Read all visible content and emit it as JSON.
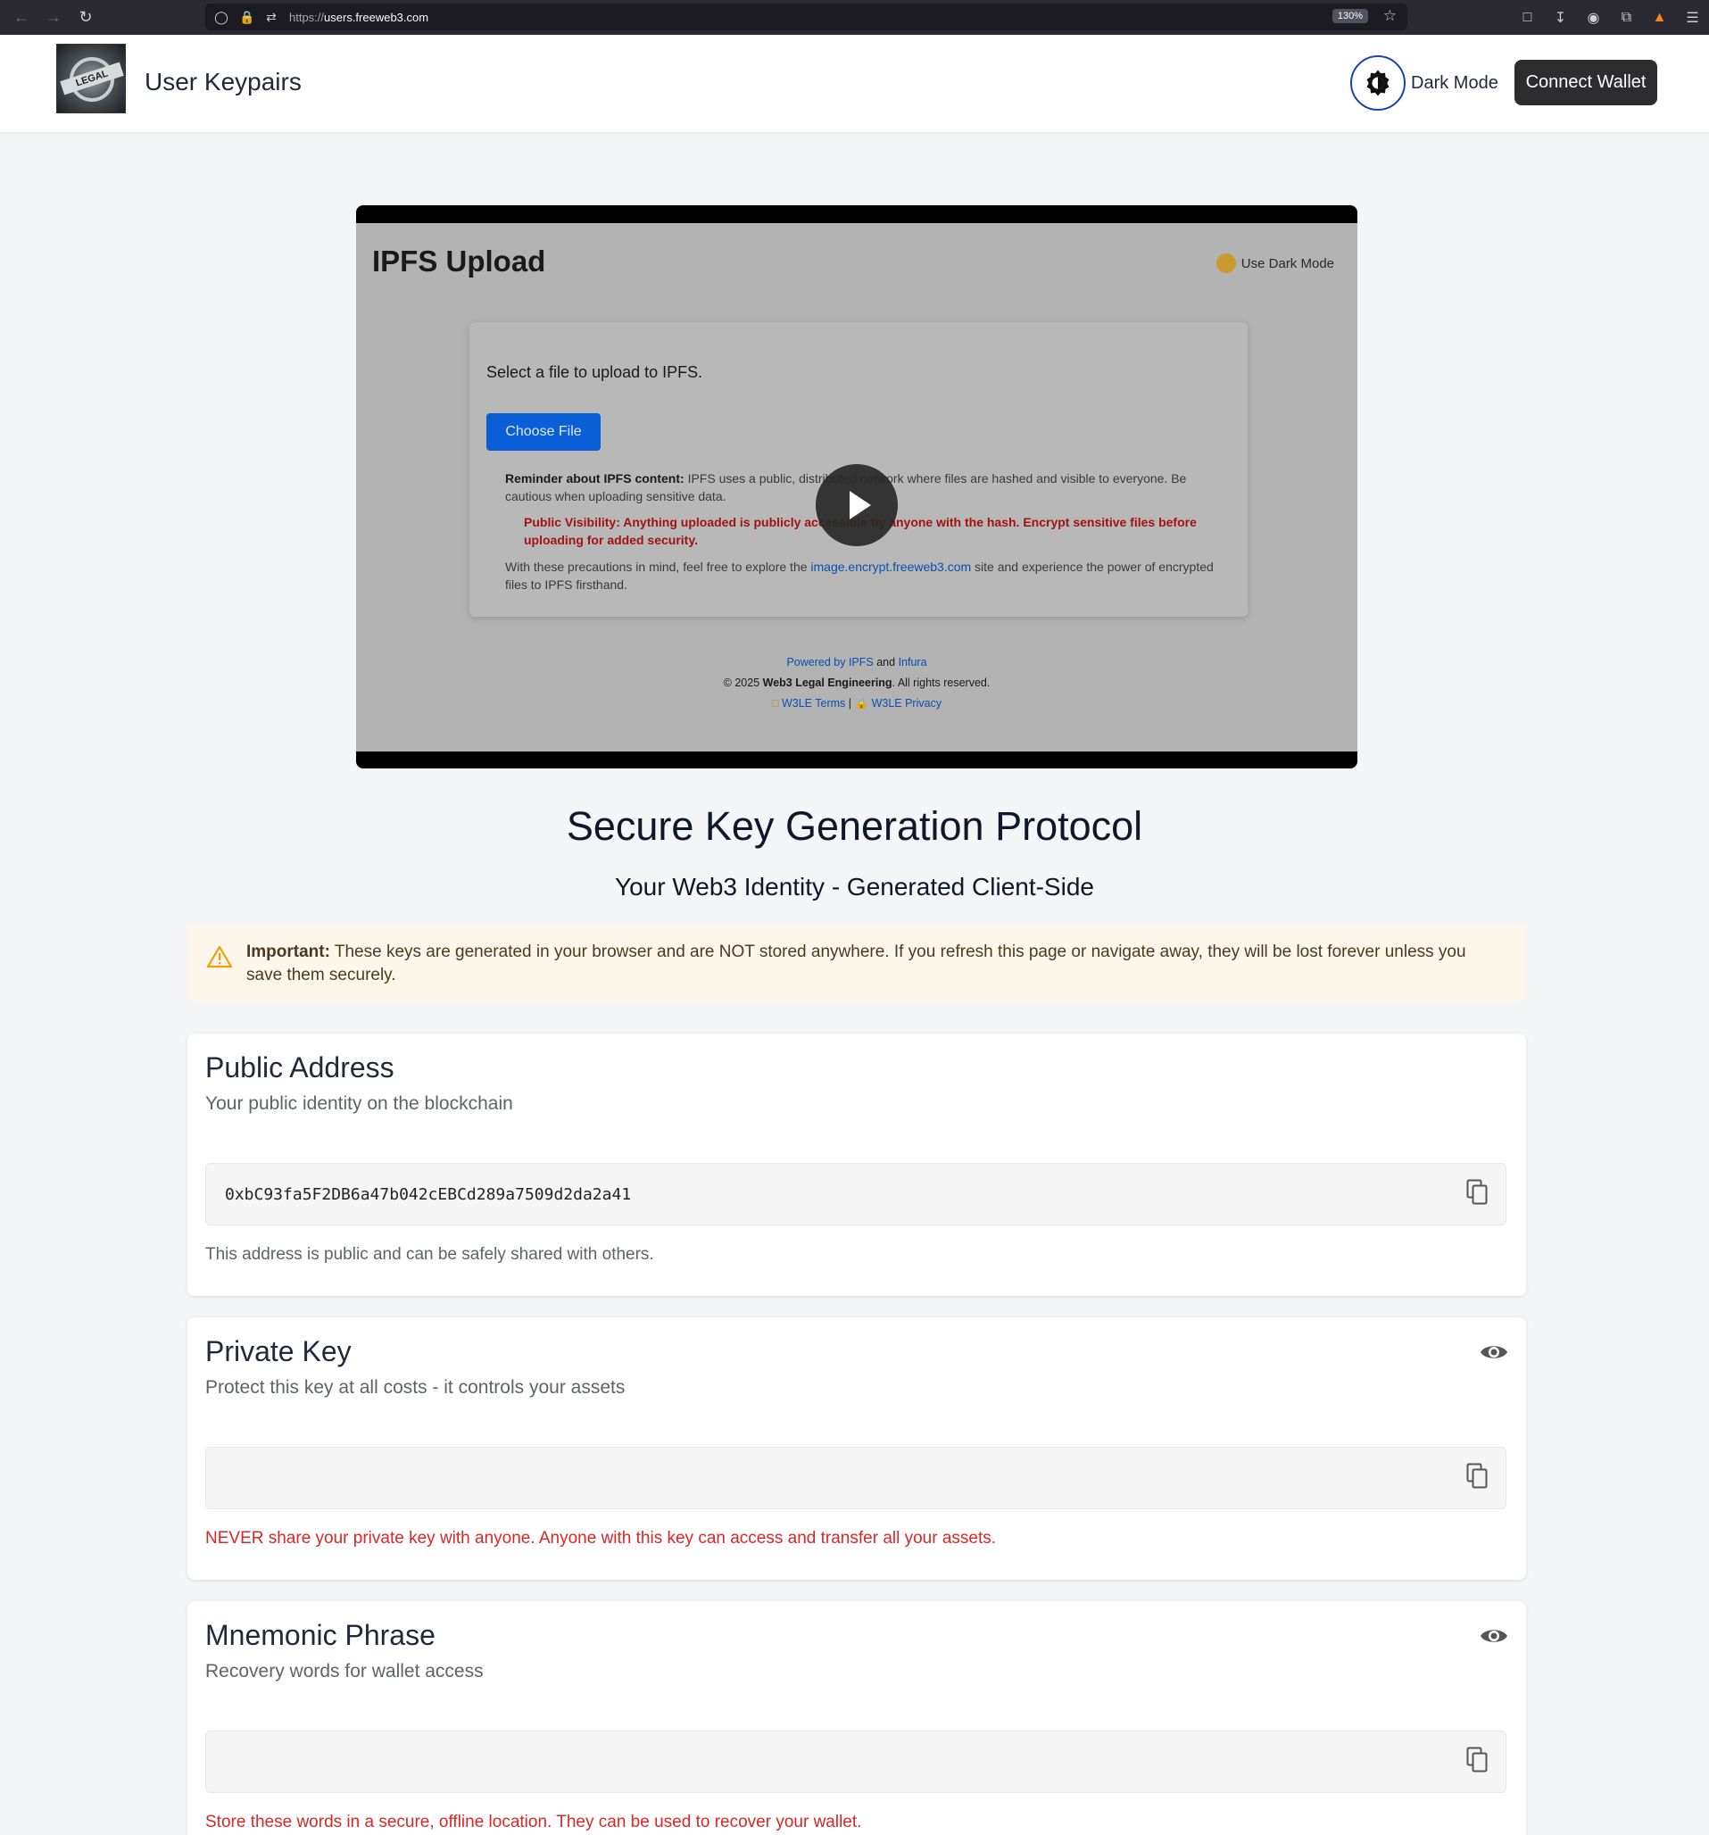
{
  "browser": {
    "url_prefix": "https://",
    "url_host": "users.freeweb3.com",
    "zoom": "130%"
  },
  "header": {
    "logo_text": "LEGAL",
    "title": "User Keypairs",
    "theme_label": "Dark Mode",
    "connect_label": "Connect Wallet"
  },
  "video": {
    "title": "IPFS Upload",
    "dark_toggle": "Use Dark Mode",
    "select_text": "Select a file to upload to IPFS.",
    "choose_file": "Choose File",
    "reminder_label": "Reminder about IPFS content:",
    "reminder_text": " IPFS uses a public, distributed network where files are hashed and visible to everyone. Be cautious when uploading sensitive data.",
    "warning": "Public Visibility: Anything uploaded is publicly accessible by anyone with the hash. Encrypt sensitive files before uploading for added security.",
    "precaution_before": "With these precautions in mind, feel free to explore the ",
    "precaution_link": "image.encrypt.freeweb3.com",
    "precaution_after": " site and experience the power of encrypted files to IPFS firsthand.",
    "footer_powered": "Powered by",
    "footer_ipfs": "IPFS",
    "footer_and": "and",
    "footer_infura": "Infura",
    "footer_copy_prefix": "© 2025 ",
    "footer_org": "Web3 Legal Engineering",
    "footer_copy_suffix": ". All rights reserved.",
    "footer_terms": "W3LE Terms",
    "footer_sep": "|",
    "footer_privacy": "W3LE Privacy"
  },
  "main": {
    "heading": "Secure Key Generation Protocol",
    "subheading": "Your Web3 Identity - Generated Client-Side"
  },
  "alert": {
    "label": "Important:",
    "text": " These keys are generated in your browser and are NOT stored anywhere. If you refresh this page or navigate away, they will be lost forever unless you save them securely."
  },
  "public_address": {
    "title": "Public Address",
    "subtitle": "Your public identity on the blockchain",
    "value": "0xbC93fa5F2DB6a47b042cEBCd289a7509d2da2a41",
    "note": "This address is public and can be safely shared with others."
  },
  "private_key": {
    "title": "Private Key",
    "subtitle": "Protect this key at all costs - it controls your assets",
    "value": "",
    "note": "NEVER share your private key with anyone. Anyone with this key can access and transfer all your assets."
  },
  "mnemonic": {
    "title": "Mnemonic Phrase",
    "subtitle": "Recovery words for wallet access",
    "value": "",
    "note": "Store these words in a secure, offline location. They can be used to recover your wallet."
  }
}
